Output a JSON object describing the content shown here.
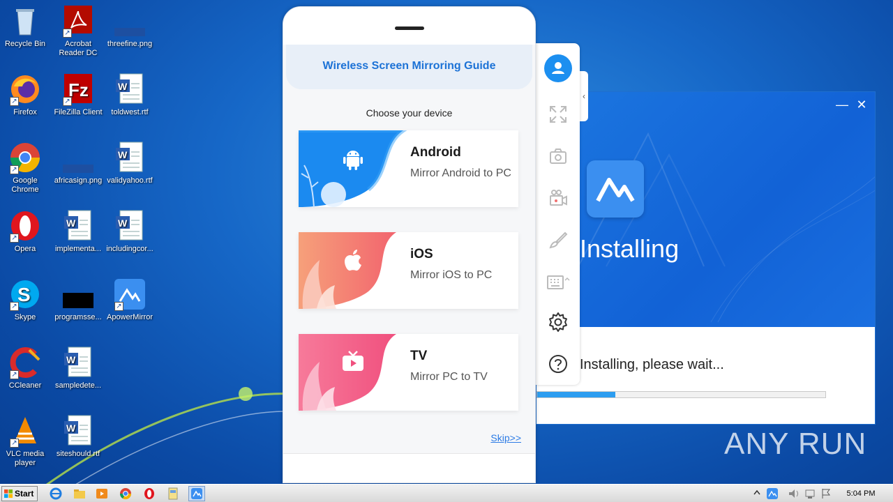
{
  "desktop": {
    "icons": [
      {
        "label": "Recycle Bin"
      },
      {
        "label": "Acrobat Reader DC"
      },
      {
        "label": "threefine.png"
      },
      {
        "label": "Firefox"
      },
      {
        "label": "FileZilla Client"
      },
      {
        "label": "toldwest.rtf"
      },
      {
        "label": "Google Chrome"
      },
      {
        "label": "africasign.png"
      },
      {
        "label": "validyahoo.rtf"
      },
      {
        "label": "Opera"
      },
      {
        "label": "implementa..."
      },
      {
        "label": "includingcor..."
      },
      {
        "label": "Skype"
      },
      {
        "label": "programsse..."
      },
      {
        "label": "ApowerMirror"
      },
      {
        "label": "CCleaner"
      },
      {
        "label": "sampledete..."
      },
      {
        "label": "VLC media player"
      },
      {
        "label": "siteshould.rtf"
      }
    ]
  },
  "guide": {
    "header": "Wireless Screen Mirroring Guide",
    "choose": "Choose your device",
    "cards": [
      {
        "title": "Android",
        "subtitle": "Mirror Android to PC"
      },
      {
        "title": "iOS",
        "subtitle": "Mirror iOS to PC"
      },
      {
        "title": "TV",
        "subtitle": "Mirror PC to TV"
      }
    ],
    "skip": "Skip>>"
  },
  "sidebar": {
    "icons": [
      "user-icon",
      "fullscreen-icon",
      "camera-icon",
      "record-icon",
      "brush-icon",
      "keyboard-icon",
      "settings-icon",
      "help-icon"
    ]
  },
  "installer": {
    "state": "Installing",
    "wait": "Installing, please wait...",
    "progress": 0.27
  },
  "watermark": "ANY RUN",
  "taskbar": {
    "start": "Start",
    "clock": "5:04 PM"
  },
  "colors": {
    "accent": "#1c72d6",
    "android": "#1a8af0",
    "ios": "#f47a70",
    "tv": "#f25a8a"
  }
}
